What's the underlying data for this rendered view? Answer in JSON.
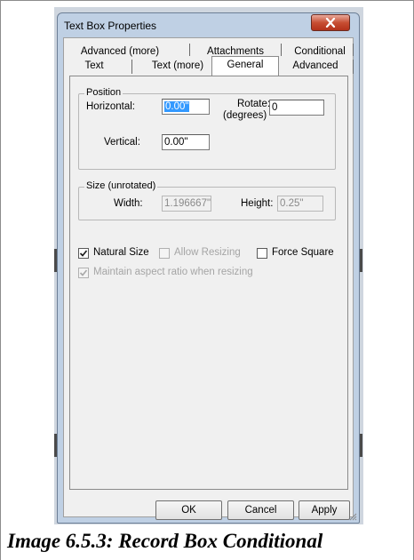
{
  "window": {
    "title": "Text Box Properties",
    "close_icon": "close-icon"
  },
  "tabs": {
    "row1": [
      "Advanced (more)",
      "Attachments",
      "Conditional"
    ],
    "row2": [
      "Text",
      "Text (more)",
      "General",
      "Advanced"
    ],
    "active": "General"
  },
  "position": {
    "legend": "Position",
    "horizontal_label": "Horizontal:",
    "horizontal_value": "0.00\"",
    "rotate_label_line1": "Rotate:",
    "rotate_label_line2": "(degrees)",
    "rotate_value": "0",
    "vertical_label": "Vertical:",
    "vertical_value": "0.00\""
  },
  "size": {
    "legend": "Size (unrotated)",
    "width_label": "Width:",
    "width_value": "1.196667\"",
    "height_label": "Height:",
    "height_value": "0.25\""
  },
  "options": {
    "natural_size": {
      "label": "Natural Size",
      "checked": true,
      "enabled": true
    },
    "allow_resizing": {
      "label": "Allow Resizing",
      "checked": false,
      "enabled": false
    },
    "force_square": {
      "label": "Force Square",
      "checked": false,
      "enabled": true
    },
    "maintain_aspect": {
      "label": "Maintain aspect ratio when resizing",
      "checked": true,
      "enabled": false
    }
  },
  "buttons": {
    "ok": "OK",
    "cancel": "Cancel",
    "apply": "Apply"
  },
  "caption": "Image 6.5.3: Record Box Conditional"
}
